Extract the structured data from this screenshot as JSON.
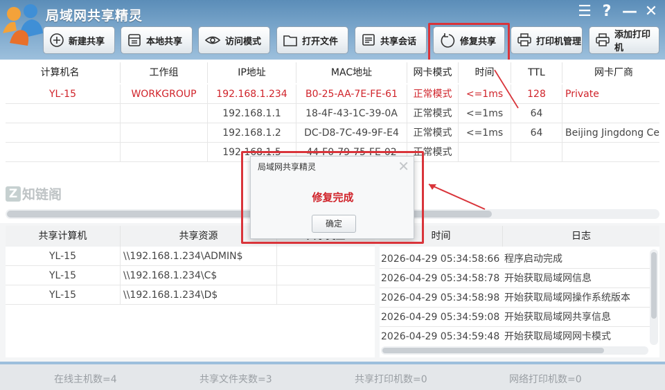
{
  "app": {
    "title": "局域网共享精灵",
    "window_controls": {
      "menu": "☰",
      "help": "?",
      "minimize": "—",
      "close": "✕"
    }
  },
  "toolbar": {
    "new_share": "新建共享",
    "local_share": "本地共享",
    "access_mode": "访问模式",
    "open_file": "打开文件",
    "share_session": "共享会话",
    "repair_share": "修复共享",
    "printer_mgmt": "打印机管理",
    "add_printer": "添加打印机"
  },
  "computers": {
    "columns": [
      "计算机名",
      "工作组",
      "IP地址",
      "MAC地址",
      "网卡模式",
      "时间",
      "TTL",
      "网卡厂商"
    ],
    "rows": [
      {
        "name": "YL-15",
        "group": "WORKGROUP",
        "ip": "192.168.1.234",
        "mac": "B0-25-AA-7E-FE-61",
        "mode": "正常模式",
        "time": "<=1ms",
        "ttl": "128",
        "vendor": "Private"
      },
      {
        "name": "",
        "group": "",
        "ip": "192.168.1.1",
        "mac": "18-4F-43-1C-39-0A",
        "mode": "正常模式",
        "time": "<=1ms",
        "ttl": "64",
        "vendor": ""
      },
      {
        "name": "",
        "group": "",
        "ip": "192.168.1.2",
        "mac": "DC-D8-7C-49-9F-E4",
        "mode": "正常模式",
        "time": "<=1ms",
        "ttl": "64",
        "vendor": "Beijing Jingdong Ce"
      },
      {
        "name": "",
        "group": "",
        "ip": "192.168.1.5",
        "mac": "44-F0-79-75-FE-02",
        "mode": "正常模式",
        "time": "",
        "ttl": "",
        "vendor": ""
      }
    ]
  },
  "watermark": {
    "mark": "Z",
    "text": "知链阁"
  },
  "shares": {
    "columns": [
      "共享计算机",
      "共享资源",
      "共享类型"
    ],
    "rows": [
      {
        "computer": "YL-15",
        "resource": "\\\\192.168.1.234\\ADMIN$",
        "type": ""
      },
      {
        "computer": "YL-15",
        "resource": "\\\\192.168.1.234\\C$",
        "type": ""
      },
      {
        "computer": "YL-15",
        "resource": "\\\\192.168.1.234\\D$",
        "type": ""
      }
    ]
  },
  "log": {
    "columns": [
      "时间",
      "日志"
    ],
    "rows": [
      {
        "time": "2026-04-29 05:34:58:66",
        "msg": "程序启动完成"
      },
      {
        "time": "2026-04-29 05:34:58:78",
        "msg": "开始获取局域网信息"
      },
      {
        "time": "2026-04-29 05:34:58:98",
        "msg": "开始获取局域网操作系统版本"
      },
      {
        "time": "2026-04-29 05:34:59:08",
        "msg": "开始获取局域网共享信息"
      },
      {
        "time": "2026-04-29 05:34:59:48",
        "msg": "开始获取局域网网卡模式"
      }
    ]
  },
  "status": {
    "online_hosts": "在线主机数=4",
    "shared_folders": "共享文件夹数=3",
    "shared_printers": "共享打印机数=0",
    "network_printers": "网络打印机数=0"
  },
  "dialog": {
    "title": "局域网共享精灵",
    "message": "修复完成",
    "ok": "确定",
    "close": "✕"
  },
  "colors": {
    "highlight": "#d9343a",
    "accent_red": "#d0232a",
    "titlebar": "#5b8db8"
  }
}
